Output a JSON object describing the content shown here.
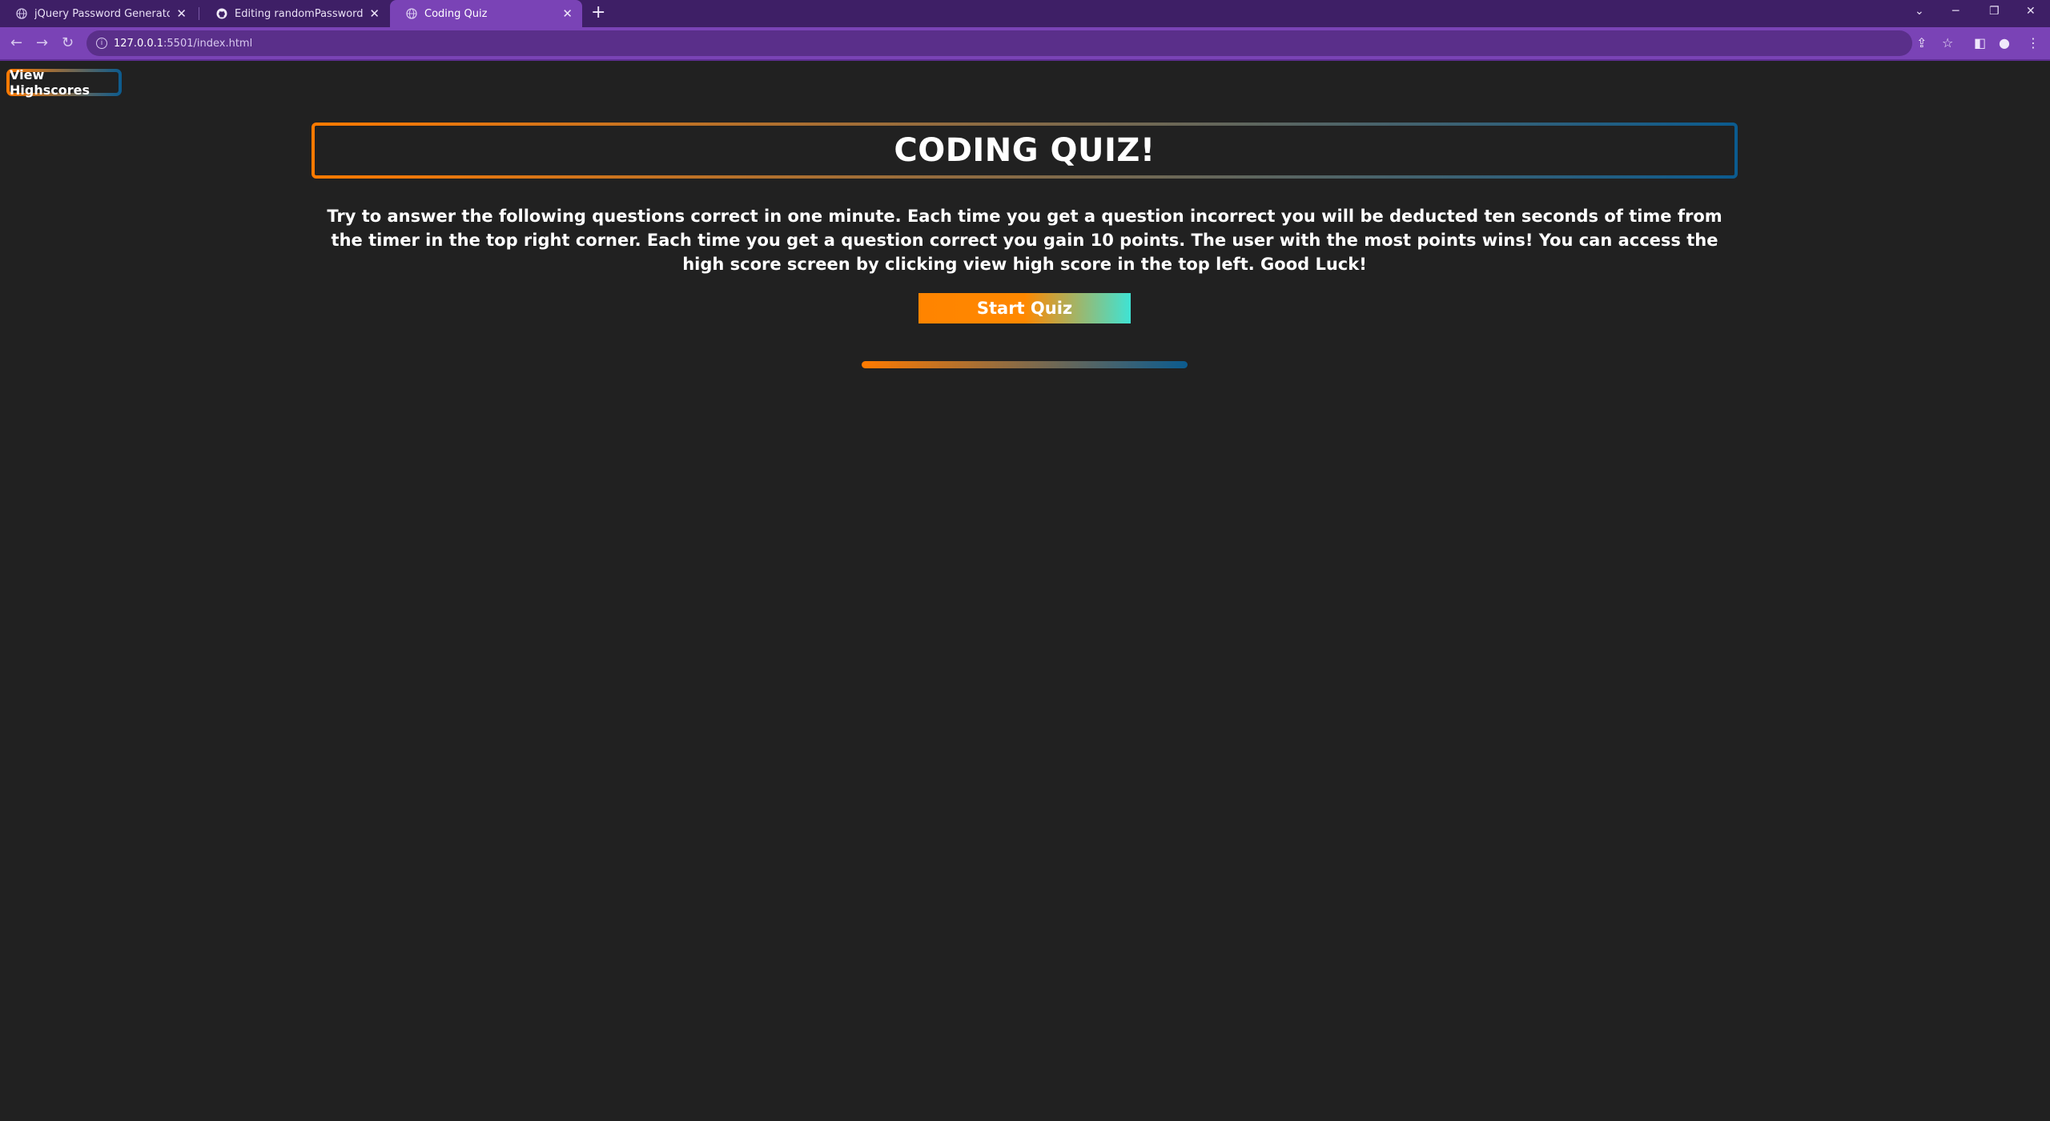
{
  "browser": {
    "tabs": [
      {
        "title": "jQuery Password Generator",
        "icon": "globe-icon",
        "active": false
      },
      {
        "title": "Editing randomPasswordGenerat",
        "icon": "github-icon",
        "active": false
      },
      {
        "title": "Coding Quiz",
        "icon": "globe-icon",
        "active": true
      }
    ],
    "tab_close_glyph": "✕",
    "new_tab_glyph": "+",
    "url_host": "127.0.0.1",
    "url_path": ":5501/index.html",
    "colors": {
      "tabstrip": "#3e1f66",
      "toolbar": "#7a43b6",
      "omnibox": "#5a2f8a"
    }
  },
  "page": {
    "highscores_label": "View Highscores",
    "title": "CODING QUIZ!",
    "intro": "Try to answer the following questions correct in one minute. Each time you get a question incorrect you will be deducted ten seconds of time from the timer in the top right corner. Each time you get a question correct you gain 10 points. The user with the most points wins! You can access the high score screen by clicking view high score in the top left. Good Luck!",
    "start_label": "Start Quiz",
    "colors": {
      "background": "#212121",
      "accent_orange": "#ff7a00",
      "accent_blue": "#0b5b8f",
      "accent_teal": "#3fe3d4"
    }
  }
}
